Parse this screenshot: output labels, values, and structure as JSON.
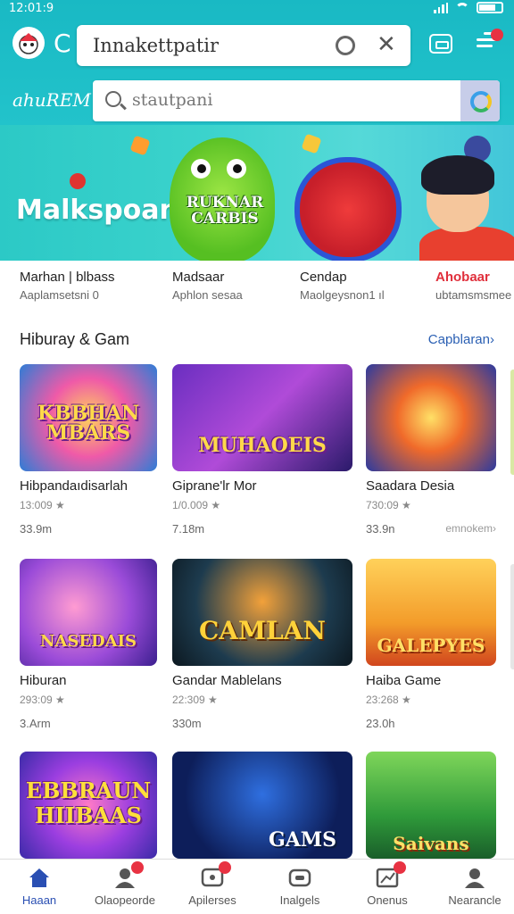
{
  "status": {
    "time": "12:01:9"
  },
  "browser": {
    "url_text": "Innakettpatir"
  },
  "header": {
    "brand": "ahuREM",
    "search_placeholder": "stautpani"
  },
  "banner": {
    "title": "Malkspoan",
    "monster_label": "RUKNAR CARBIS"
  },
  "categories": [
    {
      "name": "Marhan | blbass",
      "sub": "Aaplamsetsni 0"
    },
    {
      "name": "Madsaar",
      "sub": "Aphlon sesaa"
    },
    {
      "name": "Cendap",
      "sub": "Maolgeysnon1 ıl"
    },
    {
      "name": "Ahobaar",
      "sub": "ubtamsmsmee"
    }
  ],
  "section": {
    "title": "Hiburay & Gam",
    "link": "Capblaran›"
  },
  "games": [
    {
      "thumb_text": "KBBHAN MBARS",
      "title": "Hibpandaıdisarlah",
      "rating": "13:009 ★",
      "size": "33.9m"
    },
    {
      "thumb_text": "MUHAOEIS",
      "title": "Giprane'lr Mor",
      "rating": "1/0.009 ★",
      "size": "7.18m"
    },
    {
      "thumb_text": "",
      "title": "Saadara Desia",
      "rating": "730:09 ★",
      "size": "33.9n",
      "extra": "emnokem›"
    },
    {
      "thumb_text": "NASEDAIS",
      "title": "Hiburan",
      "rating": "293:09 ★",
      "size": "3.Arm"
    },
    {
      "thumb_text": "CAMLAN",
      "title": "Gandar Mablelans",
      "rating": "22:309 ★",
      "size": "330m"
    },
    {
      "thumb_text": "GALEPYES",
      "title": "Haiba Game",
      "rating": "23:268 ★",
      "size": "23.0h"
    },
    {
      "thumb_text": "EBBRAUN HIIBAAS",
      "title": "",
      "rating": "",
      "size": ""
    },
    {
      "thumb_text": "GAMS",
      "title": "",
      "rating": "",
      "size": ""
    },
    {
      "thumb_text": "Saivans",
      "title": "",
      "rating": "",
      "size": ""
    }
  ],
  "nav": [
    {
      "label": "Haaan",
      "icon": "home-icon"
    },
    {
      "label": "Olaopeorde",
      "icon": "profile-icon"
    },
    {
      "label": "Apilerses",
      "icon": "apps-icon"
    },
    {
      "label": "Inalgels",
      "icon": "games-icon"
    },
    {
      "label": "Onenus",
      "icon": "chart-icon"
    },
    {
      "label": "Nearancle",
      "icon": "account-icon"
    }
  ],
  "colors": {
    "teal": "#1fbec8",
    "accent_blue": "#2a4fb3",
    "badge_red": "#e83242"
  }
}
